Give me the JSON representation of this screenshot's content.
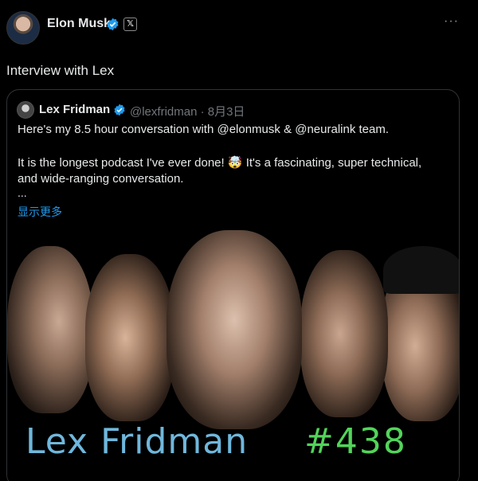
{
  "author": {
    "name": "Elon Musk",
    "avatar_icon": "profile-avatar",
    "verified_icon": "verified-badge-icon",
    "affiliation_icon": "x-logo-icon",
    "more_label": "···"
  },
  "tweet": {
    "text": "Interview with Lex"
  },
  "quote": {
    "name": "Lex Fridman",
    "handle": "@lexfridman · 8月3日",
    "line1": "Here's my 8.5 hour conversation with @elonmusk & @neuralink team.",
    "line2": "It is the longest podcast I've ever done! 🤯 It's a fascinating, super technical,",
    "line3": "and wide-ranging conversation.",
    "ellipsis": "...",
    "show_more": "显示更多"
  },
  "media": {
    "title": "Lex Fridman",
    "episode": "#438",
    "title_color": "#6fb7dc",
    "episode_color": "#52d45a"
  },
  "colors": {
    "background": "#000000",
    "link": "#1d9bf0",
    "verified": "#1d9bf0"
  }
}
